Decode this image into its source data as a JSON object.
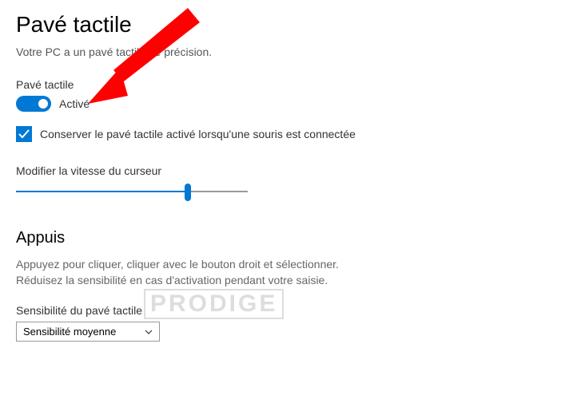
{
  "page": {
    "title": "Pavé tactile",
    "subtitle": "Votre PC a un pavé tactile de précision."
  },
  "touchpad": {
    "label": "Pavé tactile",
    "toggle_state_label": "Activé",
    "keep_with_mouse_label": "Conserver le pavé tactile activé lorsqu'une souris est connectée"
  },
  "cursor": {
    "label": "Modifier la vitesse du curseur"
  },
  "taps": {
    "heading": "Appuis",
    "description_line1": "Appuyez pour cliquer, cliquer avec le bouton droit et sélectionner.",
    "description_line2": "Réduisez la sensibilité en cas d'activation pendant votre saisie.",
    "sensitivity_label": "Sensibilité du pavé tactile",
    "sensitivity_value": "Sensibilité moyenne"
  },
  "watermark": "PRODIGE"
}
